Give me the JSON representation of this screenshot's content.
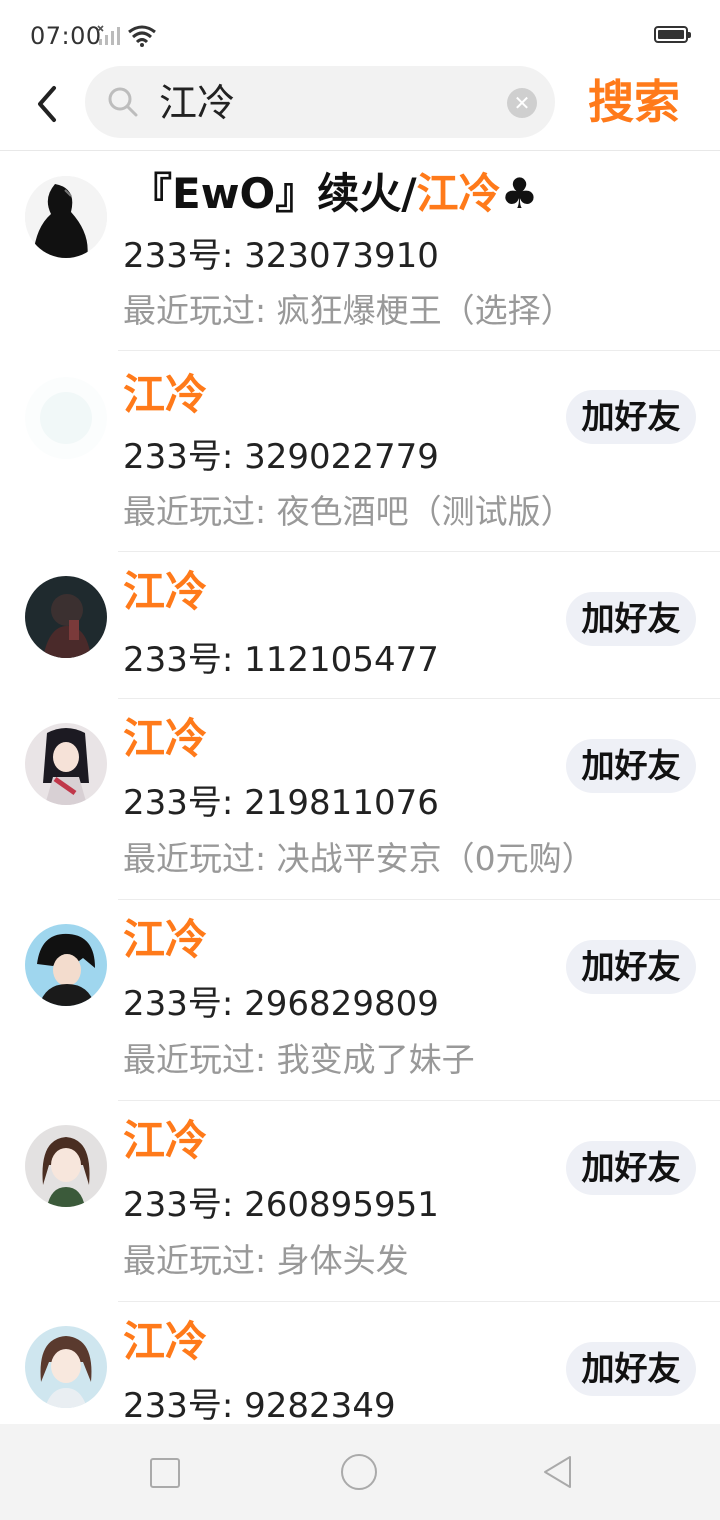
{
  "status_bar": {
    "time": "07:00"
  },
  "search": {
    "query": "江冷",
    "button_label": "搜索"
  },
  "results": [
    {
      "name_prefix": "『EwO』续火/",
      "name_highlight": "江冷",
      "name_suffix": "♣",
      "uid": "233号: 323073910",
      "recent": "最近玩过: 疯狂爆梗王（选择）",
      "add_label": "",
      "avatar": "black-white-drawing"
    },
    {
      "name_prefix": "",
      "name_highlight": "江冷",
      "name_suffix": "",
      "uid": "233号: 329022779",
      "recent": "最近玩过: 夜色酒吧（测试版）",
      "add_label": "加好友",
      "avatar": "faint-light"
    },
    {
      "name_prefix": "",
      "name_highlight": "江冷",
      "name_suffix": "",
      "uid": "233号: 112105477",
      "recent": "",
      "add_label": "加好友",
      "avatar": "dark-photo"
    },
    {
      "name_prefix": "",
      "name_highlight": "江冷",
      "name_suffix": "",
      "uid": "233号: 219811076",
      "recent": "最近玩过: 决战平安京（0元购）",
      "add_label": "加好友",
      "avatar": "anime-girl-kimono"
    },
    {
      "name_prefix": "",
      "name_highlight": "江冷",
      "name_suffix": "",
      "uid": "233号: 296829809",
      "recent": "最近玩过: 我变成了妹子",
      "add_label": "加好友",
      "avatar": "anime-boy-dark"
    },
    {
      "name_prefix": "",
      "name_highlight": "江冷",
      "name_suffix": "",
      "uid": "233号: 260895951",
      "recent": "最近玩过: 身体头发",
      "add_label": "加好友",
      "avatar": "anime-girl-brown"
    },
    {
      "name_prefix": "",
      "name_highlight": "江冷",
      "name_suffix": "",
      "uid": "233号: 9282349",
      "recent": "",
      "add_label": "加好友",
      "avatar": "anime-girl-blue"
    }
  ],
  "nav": {
    "items": [
      "recents-button",
      "home-button",
      "back-button"
    ]
  }
}
